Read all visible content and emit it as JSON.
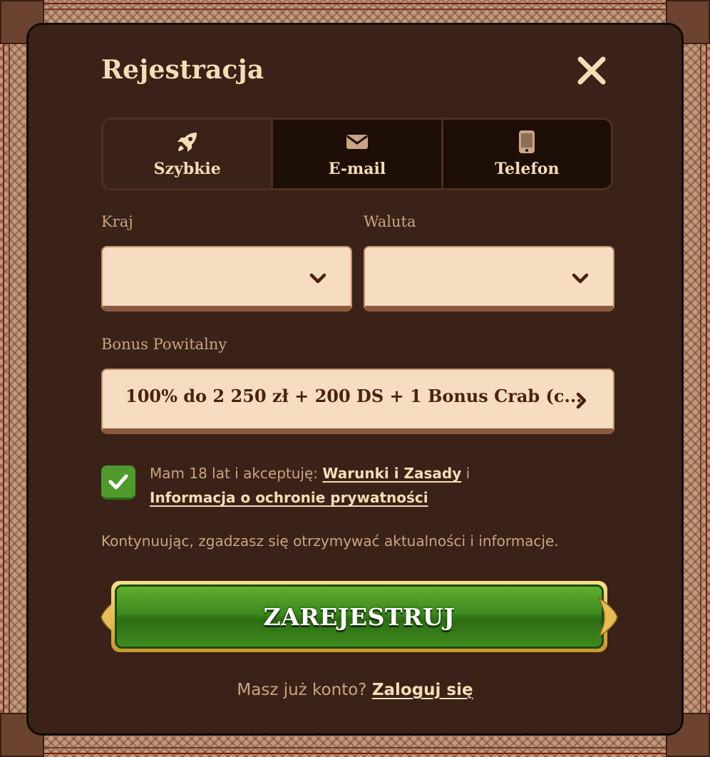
{
  "modal": {
    "title": "Rejestracja"
  },
  "tabs": [
    {
      "label": "Szybkie",
      "icon": "rocket-icon",
      "active": true
    },
    {
      "label": "E-mail",
      "icon": "envelope-icon",
      "active": false
    },
    {
      "label": "Telefon",
      "icon": "phone-icon",
      "active": false
    }
  ],
  "form": {
    "country_label": "Kraj",
    "country_value": "",
    "currency_label": "Waluta",
    "currency_value": "",
    "bonus_label": "Bonus Powitalny",
    "bonus_value": "100% do 2 250 zł + 200 DS + 1 Bonus Crab (c...",
    "terms_prefix": "Mam 18 lat i akceptuję:",
    "terms_link": "Warunki i Zasady",
    "terms_join": "i",
    "privacy_link": "Informacja o ochronie prywatności",
    "terms_checked": true,
    "notice": "Kontynuując, zgadzasz się otrzymywać aktualności i informacje.",
    "register_label": "ZAREJESTRUJ"
  },
  "footer": {
    "login_prompt": "Masz już konto?",
    "login_link": "Zaloguj się"
  },
  "colors": {
    "modal_bg": "#3a2218",
    "text_light": "#f6dcb6",
    "text_muted": "#c9a484",
    "field_bg": "#f6dcc0",
    "checkbox_green": "#4f9a2c",
    "button_green": "#3e8a1e",
    "button_gold": "#e2b850"
  }
}
